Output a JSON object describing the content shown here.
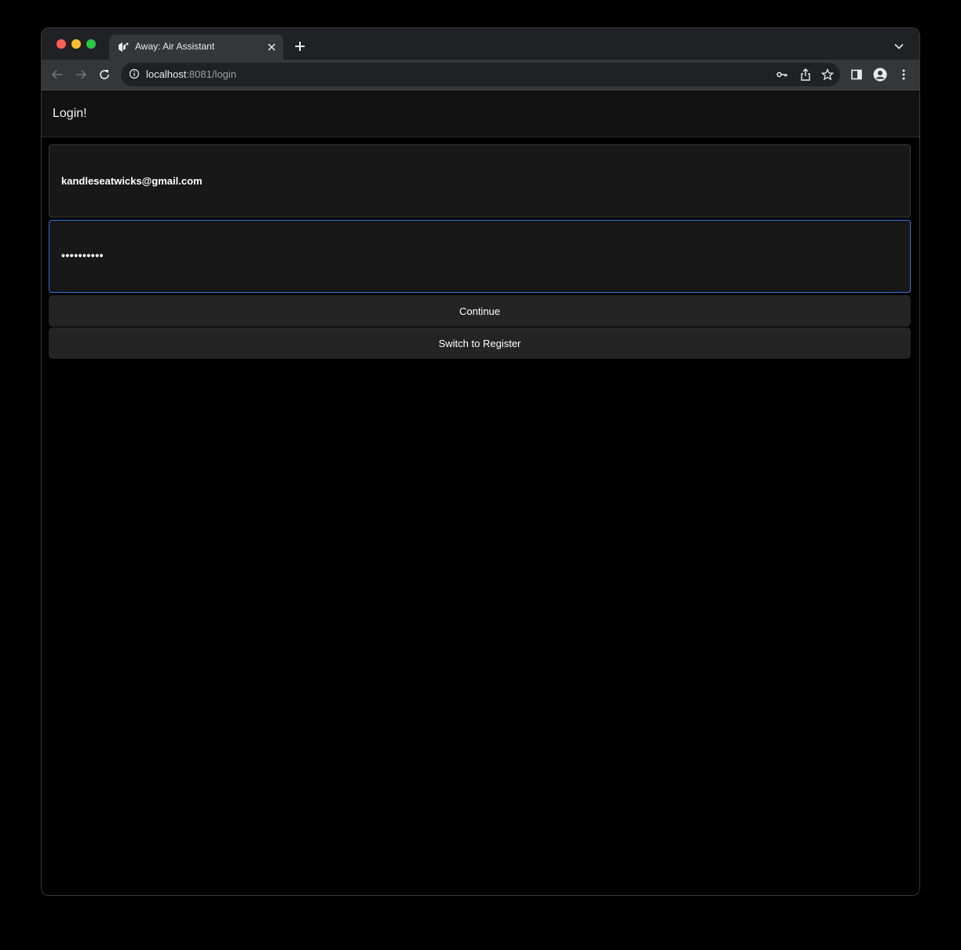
{
  "browser": {
    "tab": {
      "title": "Away: Air Assistant",
      "favicon": "app-logo-icon"
    },
    "address_bar": {
      "host": "localhost",
      "path": ":8081/login"
    },
    "icons": {
      "back": "arrow-left-icon",
      "forward": "arrow-right-icon",
      "reload": "reload-icon",
      "site_info": "info-icon",
      "password_key": "key-icon",
      "share": "share-icon",
      "bookmark": "star-icon",
      "side_panel": "side-panel-icon",
      "profile": "profile-icon",
      "menu": "kebab-menu-icon",
      "new_tab": "plus-icon",
      "tab_search": "chevron-down-icon"
    }
  },
  "app": {
    "header": {
      "title": "Login!"
    },
    "form": {
      "email_value": "kandleseatwicks@gmail.com",
      "password_masked": "••••••••••",
      "continue_label": "Continue",
      "switch_label": "Switch to Register"
    }
  },
  "colors": {
    "page_background": "#000000",
    "field_background": "#181818",
    "button_background": "#242424",
    "focus_border": "#3b6fd8"
  }
}
